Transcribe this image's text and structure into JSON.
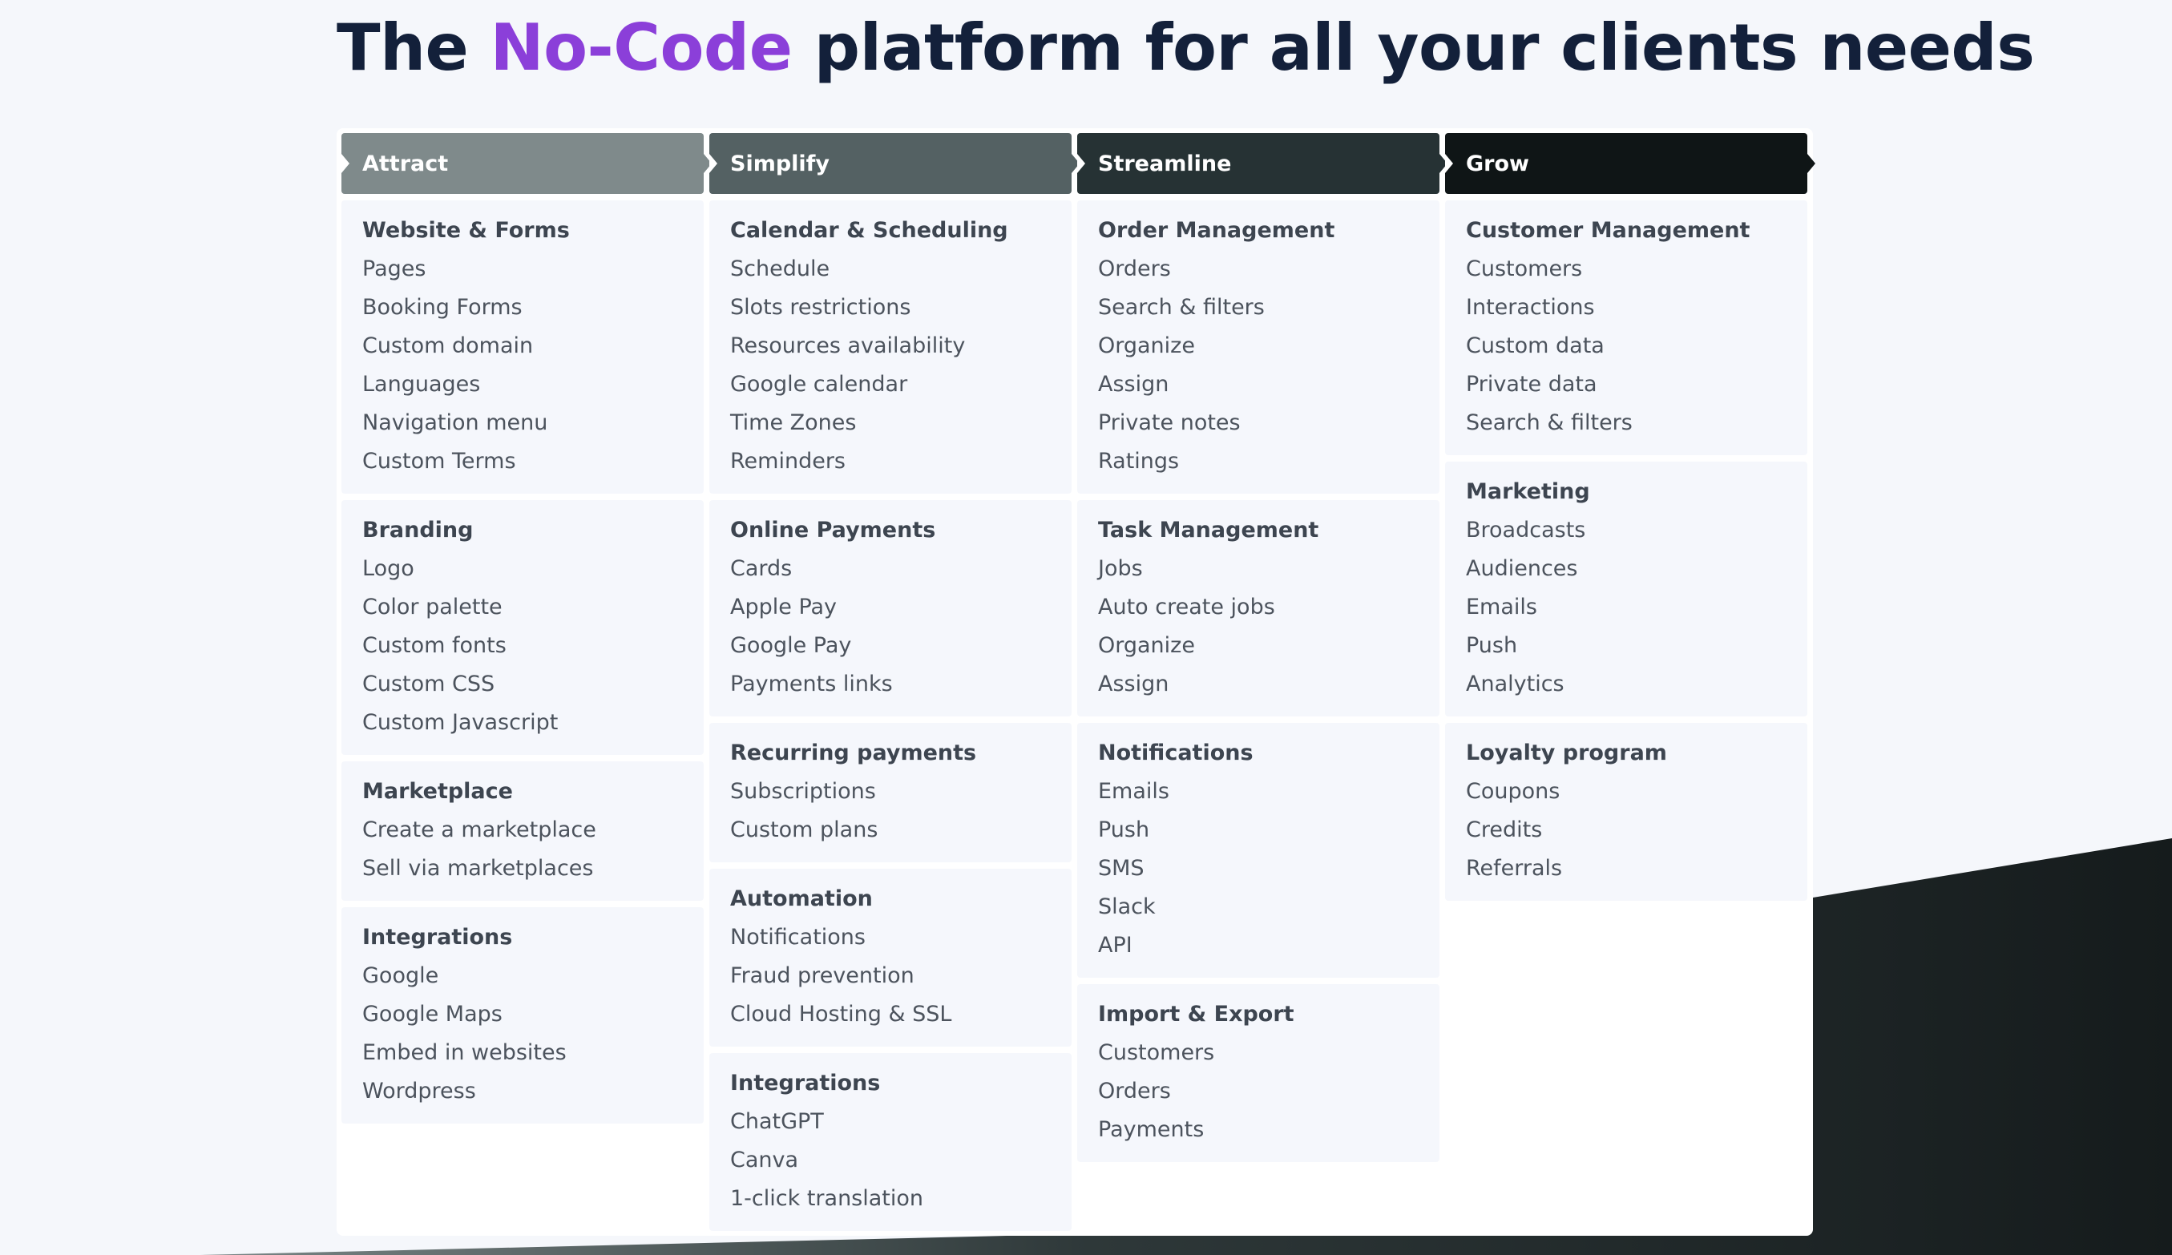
{
  "headline": {
    "before": "The ",
    "accent": "No-Code",
    "after": " platform for all your clients needs"
  },
  "colors": {
    "accent": "#8b3fd9",
    "headline": "#13203a",
    "header_attract": "#7f8a8b",
    "header_simplify": "#546163",
    "header_streamline": "#263234",
    "header_grow": "#0f1516"
  },
  "columns": [
    {
      "title": "Attract",
      "sections": [
        {
          "title": "Website & Forms",
          "items": [
            "Pages",
            "Booking Forms",
            "Custom domain",
            "Languages",
            "Navigation menu",
            "Custom Terms"
          ]
        },
        {
          "title": "Branding",
          "items": [
            "Logo",
            "Color palette",
            "Custom fonts",
            "Custom CSS",
            "Custom Javascript"
          ]
        },
        {
          "title": "Marketplace",
          "items": [
            "Create a marketplace",
            "Sell via marketplaces"
          ]
        },
        {
          "title": "Integrations",
          "items": [
            "Google",
            "Google Maps",
            "Embed in websites",
            "Wordpress"
          ]
        }
      ]
    },
    {
      "title": "Simplify",
      "sections": [
        {
          "title": "Calendar & Scheduling",
          "items": [
            "Schedule",
            "Slots restrictions",
            "Resources availability",
            "Google calendar",
            "Time Zones",
            "Reminders"
          ]
        },
        {
          "title": "Online Payments",
          "items": [
            "Cards",
            "Apple Pay",
            "Google Pay",
            "Payments links"
          ]
        },
        {
          "title": "Recurring payments",
          "items": [
            "Subscriptions",
            "Custom plans"
          ]
        },
        {
          "title": "Automation",
          "items": [
            "Notifications",
            "Fraud prevention",
            "Cloud Hosting & SSL"
          ]
        },
        {
          "title": "Integrations",
          "items": [
            "ChatGPT",
            "Canva",
            "1-click translation"
          ]
        }
      ]
    },
    {
      "title": "Streamline",
      "sections": [
        {
          "title": "Order Management",
          "items": [
            "Orders",
            "Search & filters",
            "Organize",
            "Assign",
            "Private notes",
            "Ratings"
          ]
        },
        {
          "title": "Task Management",
          "items": [
            "Jobs",
            "Auto create jobs",
            "Organize",
            "Assign"
          ]
        },
        {
          "title": "Notifications",
          "items": [
            "Emails",
            "Push",
            "SMS",
            "Slack",
            "API"
          ]
        },
        {
          "title": "Import & Export",
          "items": [
            "Customers",
            "Orders",
            "Payments"
          ]
        }
      ]
    },
    {
      "title": "Grow",
      "sections": [
        {
          "title": "Customer Management",
          "items": [
            "Customers",
            "Interactions",
            "Custom data",
            "Private data",
            "Search & filters"
          ]
        },
        {
          "title": "Marketing",
          "items": [
            "Broadcasts",
            "Audiences",
            "Emails",
            "Push",
            "Analytics"
          ]
        },
        {
          "title": "Loyalty program",
          "items": [
            "Coupons",
            "Credits",
            "Referrals"
          ]
        }
      ]
    }
  ]
}
